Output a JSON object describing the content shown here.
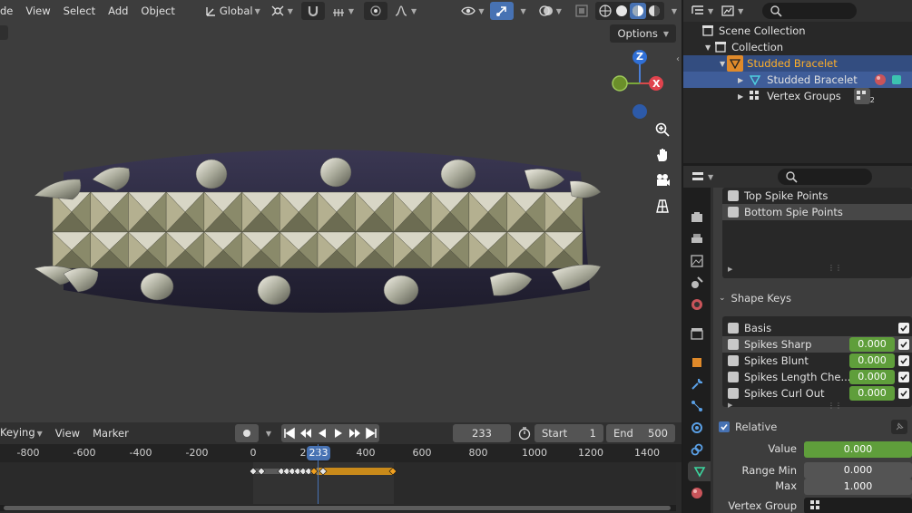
{
  "viewport": {
    "menu": [
      "de",
      "View",
      "Select",
      "Add",
      "Object"
    ],
    "transform_orientation": "Global",
    "options_label": "Options",
    "gizmo": {
      "z": "Z",
      "x": "X"
    },
    "colors": {
      "bg": "#3d3d3d",
      "band": "#2f2c46",
      "accent": "#4772b3"
    }
  },
  "timeline": {
    "menu": [
      "Keying",
      "View",
      "Marker"
    ],
    "current_frame": "233",
    "start_label": "Start",
    "start_value": "1",
    "end_label": "End",
    "end_value": "500",
    "ruler_ticks": [
      "-800",
      "-600",
      "-400",
      "-200",
      "0",
      "2",
      "400",
      "600",
      "800",
      "1000",
      "1200",
      "1400"
    ],
    "playhead_label": "233"
  },
  "outliner": {
    "rows": [
      {
        "label": "Scene Collection"
      },
      {
        "label": "Collection"
      },
      {
        "label": "Studded Bracelet"
      },
      {
        "label": "Studded Bracelet"
      },
      {
        "label": "Vertex Groups"
      }
    ],
    "vertex_groups_count": "2"
  },
  "properties": {
    "vertex_groups": [
      "Top Spike Points",
      "Bottom Spie Points"
    ],
    "shape_keys_title": "Shape Keys",
    "shape_keys": [
      {
        "name": "Basis",
        "value": ""
      },
      {
        "name": "Spikes Sharp",
        "value": "0.000"
      },
      {
        "name": "Spikes Blunt",
        "value": "0.000"
      },
      {
        "name": "Spikes Length Che...",
        "value": "0.000"
      },
      {
        "name": "Spikes Curl Out",
        "value": "0.000"
      }
    ],
    "relative_label": "Relative",
    "value_label": "Value",
    "value": "0.000",
    "range_min_label": "Range Min",
    "range_min": "0.000",
    "max_label": "Max",
    "max": "1.000",
    "vertex_group_label": "Vertex Group"
  }
}
